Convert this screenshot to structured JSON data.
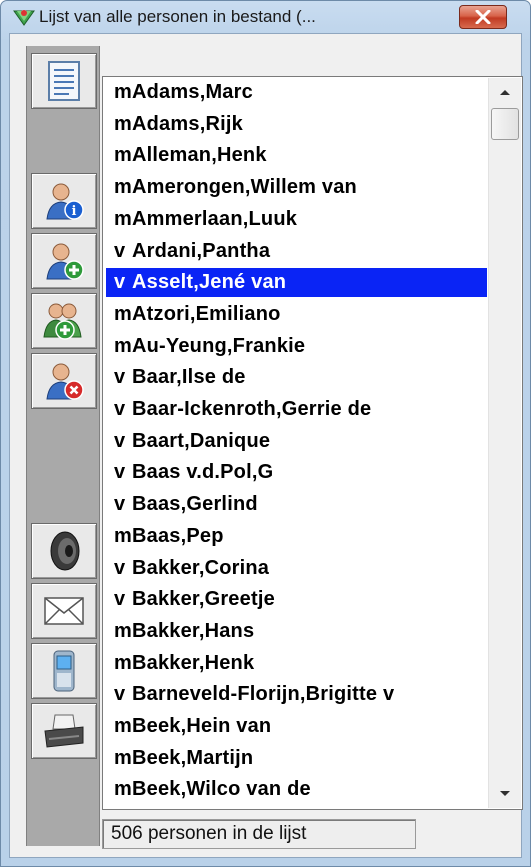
{
  "window": {
    "title": "Lijst van alle personen in bestand (..."
  },
  "toolbar": {
    "buttons": [
      {
        "icon": "list-document-icon"
      },
      {
        "icon": "person-info-icon"
      },
      {
        "icon": "person-add-icon"
      },
      {
        "icon": "group-add-icon"
      },
      {
        "icon": "person-delete-icon"
      },
      {
        "icon": "speaker-icon"
      },
      {
        "icon": "envelope-icon"
      },
      {
        "icon": "mobile-phone-icon"
      },
      {
        "icon": "printer-icon"
      }
    ]
  },
  "list": {
    "selected_index": 6,
    "items": [
      {
        "gender": "m",
        "name": "Adams,Marc"
      },
      {
        "gender": "m",
        "name": "Adams,Rijk"
      },
      {
        "gender": "m",
        "name": "Alleman,Henk"
      },
      {
        "gender": "m",
        "name": "Amerongen,Willem van"
      },
      {
        "gender": "m",
        "name": "Ammerlaan,Luuk"
      },
      {
        "gender": "v",
        "name": "Ardani,Pantha"
      },
      {
        "gender": "v",
        "name": "Asselt,Jené van"
      },
      {
        "gender": "m",
        "name": "Atzori,Emiliano"
      },
      {
        "gender": "m",
        "name": "Au-Yeung,Frankie"
      },
      {
        "gender": "v",
        "name": "Baar,Ilse de"
      },
      {
        "gender": "v",
        "name": "Baar-Ickenroth,Gerrie de"
      },
      {
        "gender": "v",
        "name": "Baart,Danique"
      },
      {
        "gender": "v",
        "name": "Baas v.d.Pol,G"
      },
      {
        "gender": "v",
        "name": "Baas,Gerlind"
      },
      {
        "gender": "m",
        "name": "Baas,Pep"
      },
      {
        "gender": "v",
        "name": "Bakker,Corina"
      },
      {
        "gender": "v",
        "name": "Bakker,Greetje"
      },
      {
        "gender": "m",
        "name": "Bakker,Hans"
      },
      {
        "gender": "m",
        "name": "Bakker,Henk"
      },
      {
        "gender": "v",
        "name": "Barneveld-Florijn,Brigitte v"
      },
      {
        "gender": "m",
        "name": "Beek,Hein van"
      },
      {
        "gender": "m",
        "name": "Beek,Martijn"
      },
      {
        "gender": "m",
        "name": "Beek,Wilco van de"
      }
    ]
  },
  "status": {
    "text": "506 personen in de lijst"
  }
}
